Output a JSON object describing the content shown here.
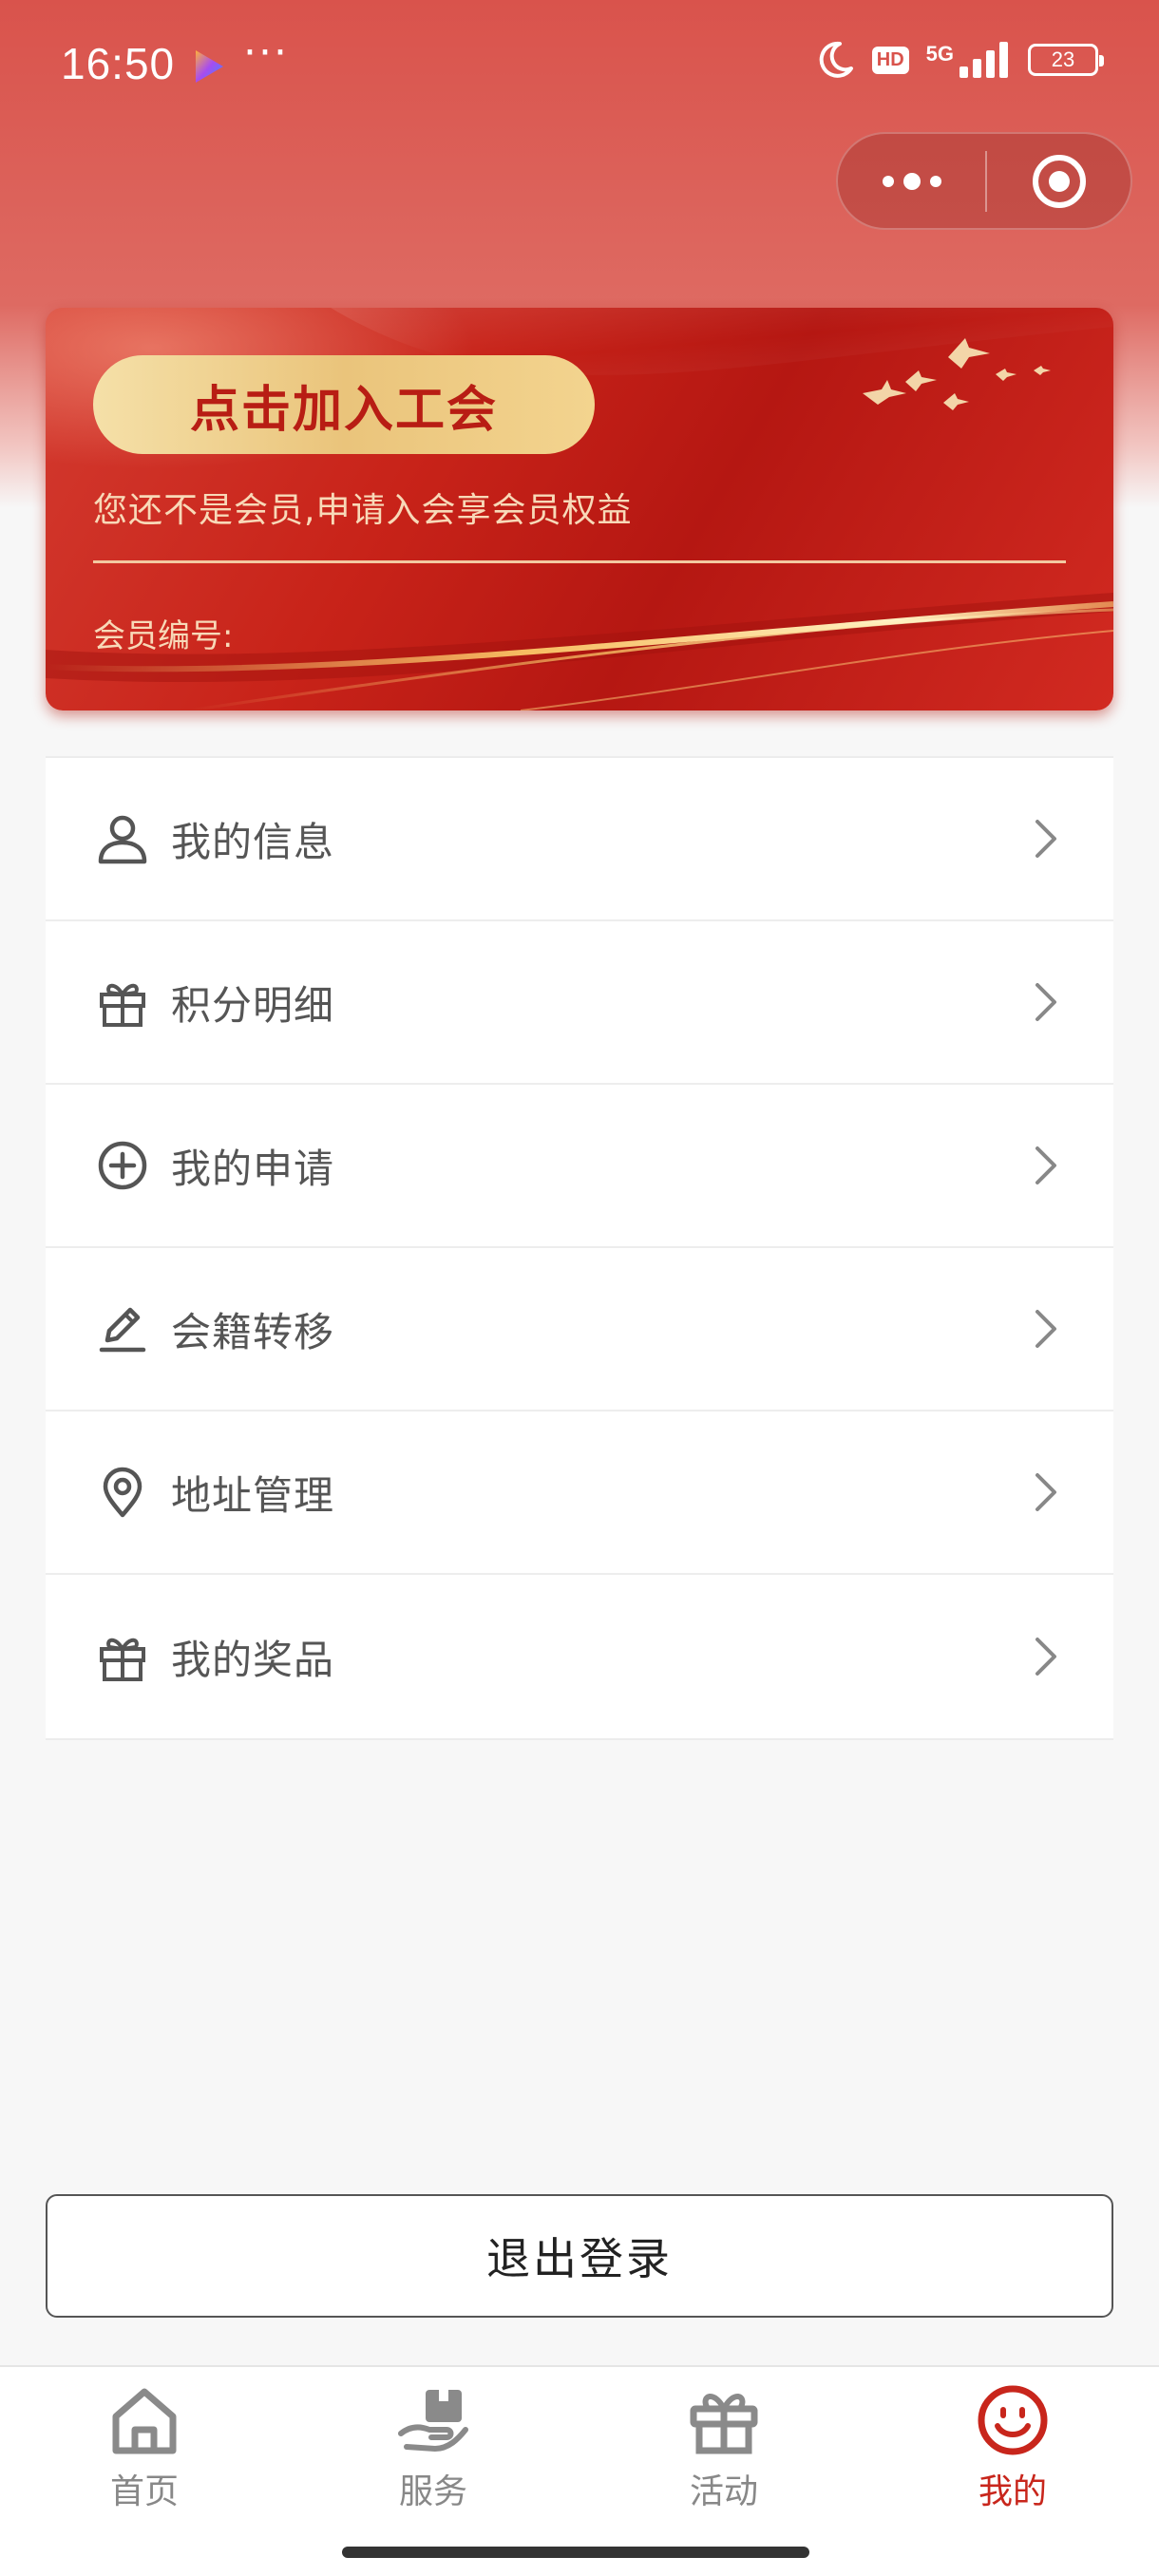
{
  "status_bar": {
    "time": "16:50",
    "dots": "···",
    "hd": "HD",
    "network": "5G",
    "battery": "23"
  },
  "card": {
    "join_label": "点击加入工会",
    "subtitle": "您还不是会员,申请入会享会员权益",
    "member_number_label": "会员编号:"
  },
  "menu": {
    "items": [
      {
        "label": "我的信息",
        "icon": "user-icon"
      },
      {
        "label": "积分明细",
        "icon": "gift-icon"
      },
      {
        "label": "我的申请",
        "icon": "plus-circle-icon"
      },
      {
        "label": "会籍转移",
        "icon": "pencil-icon"
      },
      {
        "label": "地址管理",
        "icon": "location-pin-icon"
      },
      {
        "label": "我的奖品",
        "icon": "gift-icon"
      }
    ]
  },
  "logout_label": "退出登录",
  "tabs": [
    {
      "label": "首页",
      "icon": "home-icon",
      "active": false
    },
    {
      "label": "服务",
      "icon": "service-hand-icon",
      "active": false
    },
    {
      "label": "活动",
      "icon": "gift-box-icon",
      "active": false
    },
    {
      "label": "我的",
      "icon": "smiley-icon",
      "active": true
    }
  ],
  "colors": {
    "primary_red": "#c8261c",
    "gold": "#eac47b",
    "header_red": "#d9534c"
  }
}
